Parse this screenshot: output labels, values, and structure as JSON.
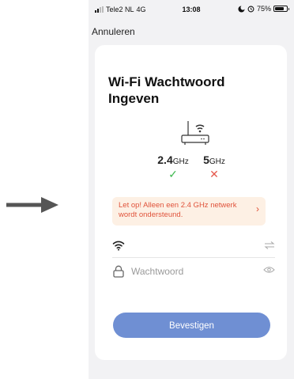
{
  "statusbar": {
    "carrier": "Tele2 NL",
    "network": "4G",
    "time": "13:08",
    "battery": "75%",
    "battery_level": 0.75
  },
  "nav": {
    "cancel_label": "Annuleren"
  },
  "card": {
    "title": "Wi-Fi Wachtwoord Ingeven",
    "bands": [
      {
        "freq": "2.4",
        "unit": "GHz",
        "supported": true,
        "mark": "✓",
        "color": "#3fb950"
      },
      {
        "freq": "5",
        "unit": "GHz",
        "supported": false,
        "mark": "✕",
        "color": "#e55a4e"
      }
    ],
    "notice": "Let op! Alleen een 2.4 GHz netwerk wordt ondersteund.",
    "wifi_field": {
      "value": "",
      "placeholder": ""
    },
    "password_field": {
      "value": "",
      "placeholder": "Wachtwoord"
    },
    "confirm_label": "Bevestigen"
  },
  "colors": {
    "accent": "#6f8fd3",
    "notice_bg": "#fdf0e4",
    "notice_text": "#e0533b",
    "check": "#3fb950",
    "cross": "#e55a4e"
  },
  "icons": [
    "arrow-right-icon",
    "signal-icon",
    "location-icon",
    "alarm-icon",
    "battery-icon",
    "router-icon",
    "wifi-icon",
    "switch-network-icon",
    "lock-icon",
    "eye-icon",
    "chevron-right-icon"
  ]
}
